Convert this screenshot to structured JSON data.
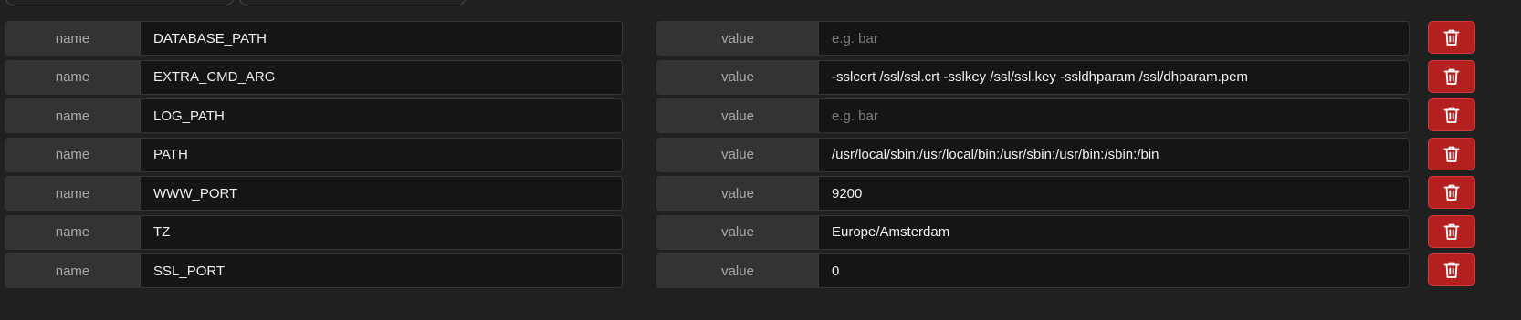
{
  "rows": [
    {
      "name_label": "name",
      "name_value": "DATABASE_PATH",
      "value_label": "value",
      "value_value": "",
      "value_placeholder": "e.g. bar",
      "delete_icon": "trash-icon"
    },
    {
      "name_label": "name",
      "name_value": "EXTRA_CMD_ARG",
      "value_label": "value",
      "value_value": "-sslcert /ssl/ssl.crt -sslkey /ssl/ssl.key -ssldhparam /ssl/dhparam.pem",
      "value_placeholder": "e.g. bar",
      "delete_icon": "trash-icon"
    },
    {
      "name_label": "name",
      "name_value": "LOG_PATH",
      "value_label": "value",
      "value_value": "",
      "value_placeholder": "e.g. bar",
      "delete_icon": "trash-icon"
    },
    {
      "name_label": "name",
      "name_value": "PATH",
      "value_label": "value",
      "value_value": "/usr/local/sbin:/usr/local/bin:/usr/sbin:/usr/bin:/sbin:/bin",
      "value_placeholder": "e.g. bar",
      "delete_icon": "trash-icon"
    },
    {
      "name_label": "name",
      "name_value": "WWW_PORT",
      "value_label": "value",
      "value_value": "9200",
      "value_placeholder": "e.g. bar",
      "delete_icon": "trash-icon"
    },
    {
      "name_label": "name",
      "name_value": "TZ",
      "value_label": "value",
      "value_value": "Europe/Amsterdam",
      "value_placeholder": "e.g. bar",
      "delete_icon": "trash-icon"
    },
    {
      "name_label": "name",
      "name_value": "SSL_PORT",
      "value_label": "value",
      "value_value": "0",
      "value_placeholder": "e.g. bar",
      "delete_icon": "trash-icon"
    }
  ],
  "colors": {
    "background": "#202020",
    "addon_background": "#333333",
    "input_background": "#151515",
    "delete_button": "#b4201f",
    "text": "#f0f0f0",
    "placeholder": "#7d7d7d"
  }
}
